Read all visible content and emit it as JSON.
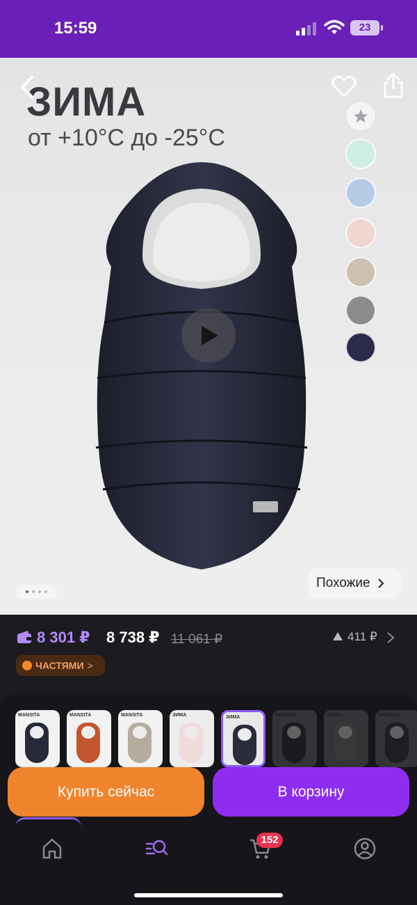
{
  "status_bar": {
    "time": "15:59",
    "battery": "23"
  },
  "hero": {
    "title": "ЗИМА",
    "subtitle": "от +10°С до -25°С",
    "swatches": [
      "#cfeee6",
      "#b6cbe6",
      "#f1d6d0",
      "#ccc0b0",
      "#8c8c8e",
      "#2c2c4a"
    ],
    "similar_label": "Похожие",
    "page_dots": 4,
    "active_dot": 0
  },
  "price": {
    "main": "8 301 ₽",
    "alt": "8 738 ₽",
    "old": "11 061 ₽",
    "increase": "411 ₽",
    "installments_label": "ЧАСТЯМИ",
    "installments_chevron": ">"
  },
  "variants": [
    {
      "label": "MANSITA",
      "color": "#262a3a",
      "bg": "#f2f2f2"
    },
    {
      "label": "MANSITA",
      "color": "#c2562f",
      "bg": "#f2f2f2"
    },
    {
      "label": "MANSITA",
      "color": "#b5aca0",
      "bg": "#f2f2f2"
    },
    {
      "label": "ЗИМА",
      "color": "#f1dcdc",
      "bg": "#ededed"
    },
    {
      "label": "ЗИМА",
      "color": "#2a2d3a",
      "bg": "#e9e9e9"
    },
    {
      "label": "MANSITA",
      "color": "#26262c",
      "bg": "#6d6d70"
    },
    {
      "label": "ЗИМА",
      "color": "#7a7a70",
      "bg": "#6d6d70"
    },
    {
      "label": "MANSITA",
      "color": "#2e2e34",
      "bg": "#6d6d70"
    }
  ],
  "actions": {
    "buy_now": "Купить сейчас",
    "add_to_cart": "В корзину"
  },
  "nav": {
    "cart_count": "152"
  },
  "colors": {
    "accent": "#8f2cf2",
    "buy": "#f0842c",
    "status_bar": "#6a1fb8"
  }
}
